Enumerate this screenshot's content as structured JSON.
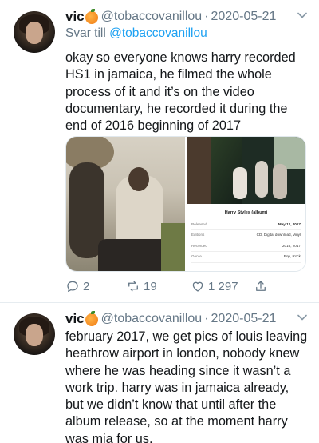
{
  "tweets": [
    {
      "name": "vic",
      "handle": "@tobaccovanillou",
      "date": "2020-05-21",
      "reply_prefix": "Svar till",
      "reply_handle": "@tobaccovanillou",
      "text": "okay so everyone knows harry recorded HS1 in jamaica, he filmed the whole process of it and it’s on the video documentary, he recorded it during the end of 2016 beginning of 2017",
      "media_info": {
        "title": "Harry Styles (album)",
        "rows": [
          {
            "key": "Released",
            "value": "May 12, 2017"
          },
          {
            "key": "Editions",
            "value": "CD, Digital download, Vinyl"
          },
          {
            "key": "Recorded",
            "value": "2016, 2017"
          },
          {
            "key": "Genre",
            "value": "Pop, Rock"
          }
        ]
      },
      "stats": {
        "replies": "2",
        "retweets": "19",
        "likes": "1 297"
      }
    },
    {
      "name": "vic",
      "handle": "@tobaccovanillou",
      "date": "2020-05-21",
      "text": "february 2017, we get pics of louis leaving heathrow airport in london, nobody knew where he was heading since it wasn’t a work trip. harry was in jamaica already, but we didn’t know that until after the album release, so at the moment harry was mia for us."
    }
  ],
  "separator_dot": "·",
  "colors": {
    "text": "#14171a",
    "secondary": "#657786",
    "link": "#1da1f2",
    "border": "#e1e8ed"
  },
  "icons": {
    "reply": "reply-icon",
    "retweet": "retweet-icon",
    "like": "heart-icon",
    "share": "share-icon",
    "menu": "chevron-down-icon",
    "emoji": "tangerine-emoji"
  }
}
